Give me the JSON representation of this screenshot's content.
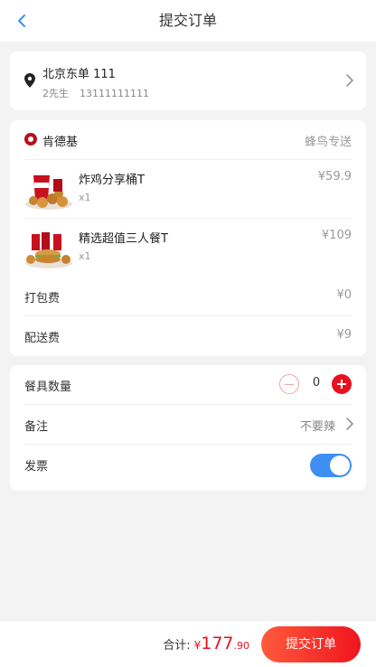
{
  "header": {
    "title": "提交订单"
  },
  "address": {
    "line": "北京东单 111",
    "name": "2先生",
    "phone": "13111111111"
  },
  "shop": {
    "name": "肯德基",
    "delivery": "蜂鸟专送"
  },
  "items": [
    {
      "name": "炸鸡分享桶T",
      "qty": "x1",
      "price": "¥59.9"
    },
    {
      "name": "精选超值三人餐T",
      "qty": "x1",
      "price": "¥109"
    }
  ],
  "fees": {
    "packing_label": "打包费",
    "packing_value": "¥0",
    "delivery_label": "配送费",
    "delivery_value": "¥9"
  },
  "options": {
    "tableware_label": "餐具数量",
    "tableware_count": "0",
    "remark_label": "备注",
    "remark_value": "不要辣",
    "invoice_label": "发票",
    "invoice_on": true
  },
  "footer": {
    "total_label": "合计:",
    "currency": "¥",
    "total_int": "177",
    "total_dec": ".90",
    "submit_label": "提交订单"
  },
  "colors": {
    "accent_red": "#e8101f",
    "toggle_blue": "#3d8ff2",
    "back_blue": "#3d8ff2"
  },
  "icons": [
    "back-arrow-icon",
    "location-pin-icon",
    "chevron-right-icon",
    "kfc-logo-icon",
    "minus-icon",
    "plus-icon"
  ]
}
